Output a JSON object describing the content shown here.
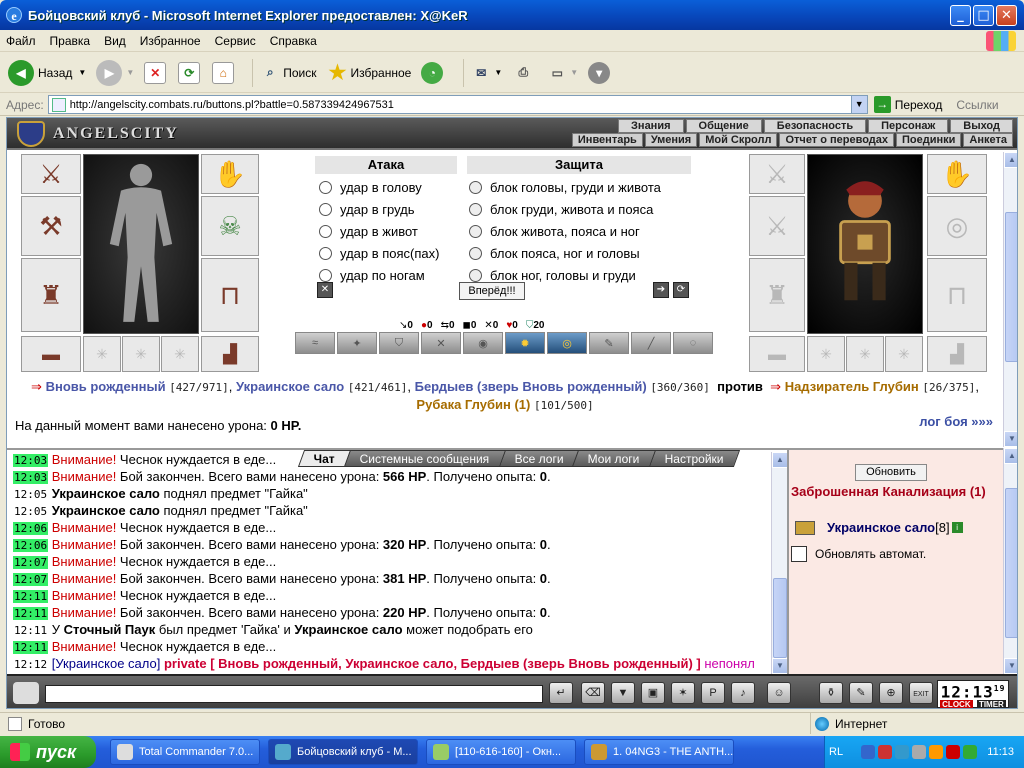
{
  "window": {
    "title": "Бойцовский клуб - Microsoft Internet Explorer предоставлен: X@KeR"
  },
  "menu": [
    "Файл",
    "Правка",
    "Вид",
    "Избранное",
    "Сервис",
    "Справка"
  ],
  "toolbar": {
    "back": "Назад",
    "search": "Поиск",
    "favorites": "Избранное"
  },
  "address": {
    "label": "Адрес:",
    "url": "http://angelscity.combats.ru/buttons.pl?battle=0.587339424967531",
    "go": "Переход",
    "links": "Ссылки"
  },
  "game": {
    "logo": "ANGELSCITY",
    "topmenu1": [
      "Знания",
      "Общение",
      "Безопасность",
      "Персонаж",
      "Выход"
    ],
    "topmenu2": [
      "Инвентарь",
      "Умения",
      "Мой Скролл",
      "Отчет о переводах",
      "Поединки",
      "Анкета"
    ],
    "attack": {
      "title": "Атака",
      "options": [
        "удар в голову",
        "удар в грудь",
        "удар в живот",
        "удар в пояс(пах)",
        "удар по ногам"
      ]
    },
    "defense": {
      "title": "Защита",
      "options": [
        "блок головы, груди и живота",
        "блок груди, живота и пояса",
        "блок живота, пояса и ног",
        "блок пояса, ног и головы",
        "блок ног, головы и груди"
      ]
    },
    "forward_button": "Вперёд!!!",
    "stats": [
      "0",
      "0",
      "0",
      "0",
      "0",
      "0",
      "20"
    ],
    "vs": {
      "team1": [
        {
          "name": "Вновь рожденный",
          "lvl": "[427/971]"
        },
        {
          "name": "Украинское сало",
          "lvl": "[421/461]"
        },
        {
          "name": "Бердыев (зверь Вновь рожденный)",
          "lvl": "[360/360]"
        }
      ],
      "versus": "против",
      "team2": [
        {
          "name": "Надзиратель Глубин",
          "lvl": "[26/375]"
        },
        {
          "name": "Рубака Глубин (1)",
          "lvl": "[101/500]"
        }
      ]
    },
    "damage_text": "На данный момент вами нанесено урона:",
    "damage_value": "0 HP.",
    "log_link": "лог боя »»»"
  },
  "chat": {
    "tabs": [
      "Чат",
      "Системные сообщения",
      "Все логи",
      "Мои логи",
      "Настройки"
    ],
    "lines": [
      {
        "t": "12:03",
        "g": true,
        "a": "Внимание!",
        "b": " Чеснок нуждается в еде..."
      },
      {
        "t": "12:03",
        "g": true,
        "a": "Внимание!",
        "b": " Бой закончен. Всего вами нанесено урона: ",
        "c": "566 HP",
        "d": ". Получено опыта: ",
        "e": "0",
        "f": "."
      },
      {
        "t": "12:05",
        "g": false,
        "n": "Украинское сало",
        "b": " поднял предмет \"Гайка\""
      },
      {
        "t": "12:05",
        "g": false,
        "n": "Украинское сало",
        "b": " поднял предмет \"Гайка\""
      },
      {
        "t": "12:06",
        "g": true,
        "a": "Внимание!",
        "b": " Чеснок нуждается в еде..."
      },
      {
        "t": "12:06",
        "g": true,
        "a": "Внимание!",
        "b": " Бой закончен. Всего вами нанесено урона: ",
        "c": "320 HP",
        "d": ". Получено опыта: ",
        "e": "0",
        "f": "."
      },
      {
        "t": "12:07",
        "g": true,
        "a": "Внимание!",
        "b": " Чеснок нуждается в еде..."
      },
      {
        "t": "12:07",
        "g": true,
        "a": "Внимание!",
        "b": " Бой закончен. Всего вами нанесено урона: ",
        "c": "381 HP",
        "d": ". Получено опыта: ",
        "e": "0",
        "f": "."
      },
      {
        "t": "12:11",
        "g": true,
        "a": "Внимание!",
        "b": " Чеснок нуждается в еде..."
      },
      {
        "t": "12:11",
        "g": true,
        "a": "Внимание!",
        "b": " Бой закончен. Всего вами нанесено урона: ",
        "c": "220 HP",
        "d": ". Получено опыта: ",
        "e": "0",
        "f": "."
      },
      {
        "t": "12:11",
        "g": false,
        "pre": "У ",
        "n": "Сточный Паук",
        "b": " был предмет 'Гайка' и ",
        "n2": "Украинское сало",
        "b2": " может подобрать его"
      },
      {
        "t": "12:11",
        "g": true,
        "a": "Внимание!",
        "b": " Чеснок нуждается в еде..."
      }
    ],
    "private_line": {
      "t": "12:12",
      "from": "[Украинское сало]",
      "to": " private [ Вновь рожденный, Украинское сало, Бердыев (зверь Вновь",
      "to2": "рожденный) ]",
      "msg": " непонял"
    }
  },
  "side": {
    "refresh": "Обновить",
    "location": "Заброшенная Канализация (1)",
    "user": "Украинское сало",
    "user_level": "[8]",
    "auto_refresh": "Обновлять автомат."
  },
  "clock": {
    "time": "12:13",
    "sec": "19",
    "label1": "CLOCK",
    "label2": "TIMER",
    "exit": "EXIT"
  },
  "statusbar": {
    "status": "Готово",
    "zone": "Интернет"
  },
  "taskbar": {
    "start": "пуск",
    "tasks": [
      "Total Commander 7.0...",
      "Бойцовский клуб - M...",
      "[110-616-160] - Окн...",
      "1. 04NG3 - THE ANTH..."
    ],
    "lang": "RL",
    "time": "11:13"
  }
}
